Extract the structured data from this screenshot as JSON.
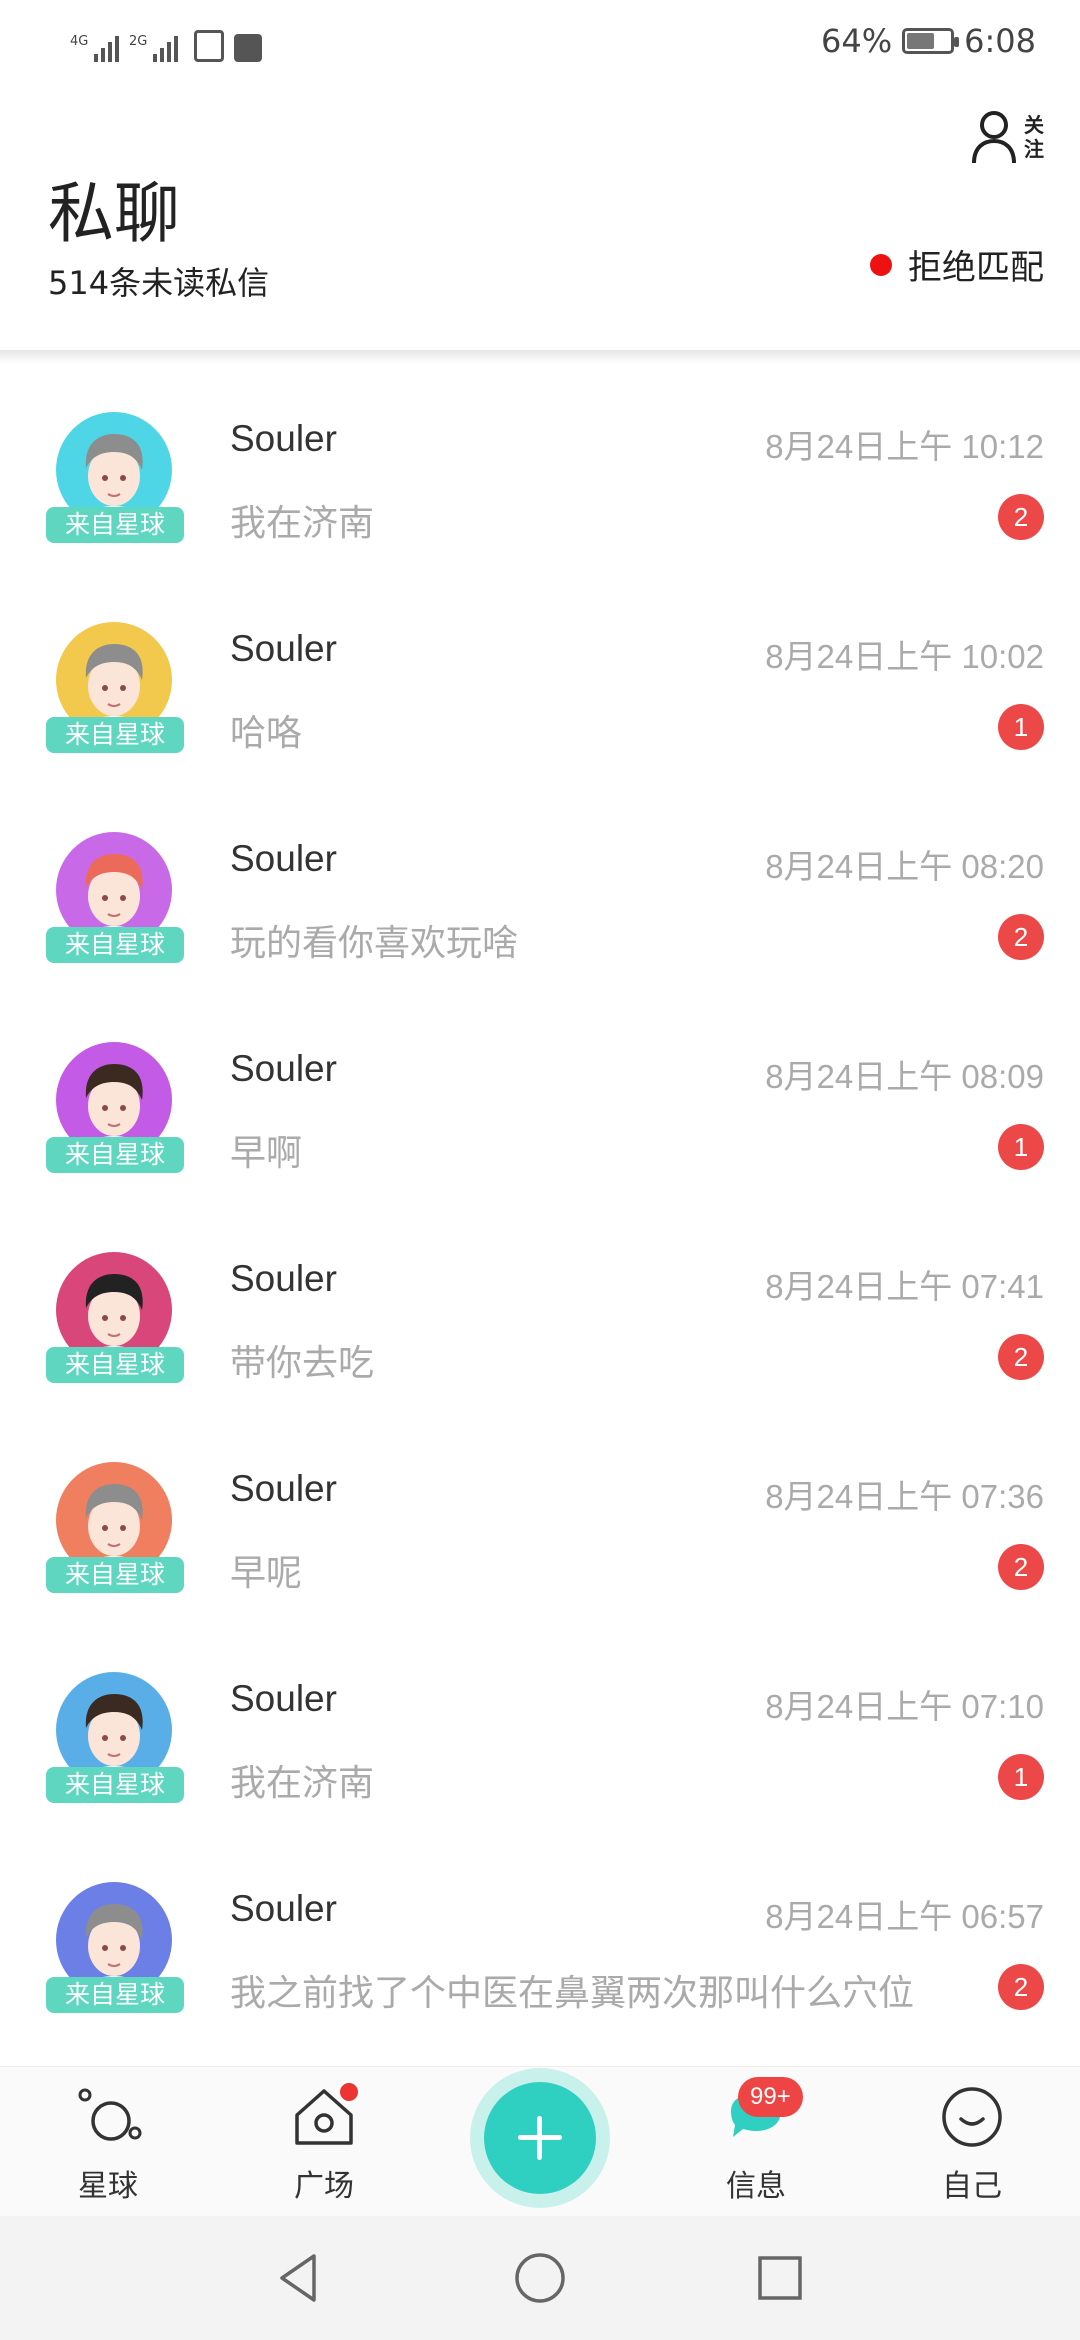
{
  "status_bar": {
    "net1": "4G",
    "net2": "2G",
    "battery_percent": "64%",
    "battery_level": 0.64,
    "time": "6:08"
  },
  "header": {
    "title": "私聊",
    "unread_summary": "514条未读私信",
    "follow_label": "关注",
    "match_toggle_label": "拒绝匹配",
    "match_dot_color": "#ee1111"
  },
  "messages": [
    {
      "sender": "Souler",
      "time": "8月24日上午 10:12",
      "preview": "我在济南",
      "unread": "2",
      "origin": "来自星球",
      "avatar_color": "#4fd6e6",
      "avatar_icon": "gray-hair-boy-avatar"
    },
    {
      "sender": "Souler",
      "time": "8月24日上午 10:02",
      "preview": "哈咯",
      "unread": "1",
      "origin": "来自星球",
      "avatar_color": "#f2c94c",
      "avatar_icon": "gray-hair-boy-avatar"
    },
    {
      "sender": "Souler",
      "time": "8月24日上午 08:20",
      "preview": "玩的看你喜欢玩啥",
      "unread": "2",
      "origin": "来自星球",
      "avatar_color": "#c86ae8",
      "avatar_icon": "red-hair-boy-avatar"
    },
    {
      "sender": "Souler",
      "time": "8月24日上午 08:09",
      "preview": "早啊",
      "unread": "1",
      "origin": "来自星球",
      "avatar_color": "#c35be6",
      "avatar_icon": "dark-hair-man-avatar"
    },
    {
      "sender": "Souler",
      "time": "8月24日上午 07:41",
      "preview": " 带你去吃",
      "unread": "2",
      "origin": "来自星球",
      "avatar_color": "#d9467a",
      "avatar_icon": "black-hair-boy-avatar"
    },
    {
      "sender": "Souler",
      "time": "8月24日上午 07:36",
      "preview": "早呢",
      "unread": "2",
      "origin": "来自星球",
      "avatar_color": "#ef7f5e",
      "avatar_icon": "gray-hair-boy-avatar"
    },
    {
      "sender": "Souler",
      "time": "8月24日上午 07:10",
      "preview": "我在济南",
      "unread": "1",
      "origin": "来自星球",
      "avatar_color": "#5aaee8",
      "avatar_icon": "dark-hair-man-avatar"
    },
    {
      "sender": "Souler",
      "time": "8月24日上午 06:57",
      "preview": "我之前找了个中医在鼻翼两次那叫什么穴位",
      "unread": "2",
      "origin": "来自星球",
      "avatar_color": "#6c7fe6",
      "avatar_icon": "gray-hair-boy-avatar"
    }
  ],
  "tab_bar": {
    "tabs": [
      {
        "label": "星球",
        "icon": "planet-icon"
      },
      {
        "label": "广场",
        "icon": "home-icon"
      },
      {
        "label": "信息",
        "icon": "chat-icon"
      },
      {
        "label": "自己",
        "icon": "smile-icon"
      }
    ],
    "messages_badge": "99+",
    "fab_icon": "plus-icon",
    "accent": "#2fd0c2"
  },
  "nav_bar": {
    "back_icon": "back-triangle-icon",
    "home_icon": "home-circle-icon",
    "recents_icon": "recents-square-icon"
  }
}
